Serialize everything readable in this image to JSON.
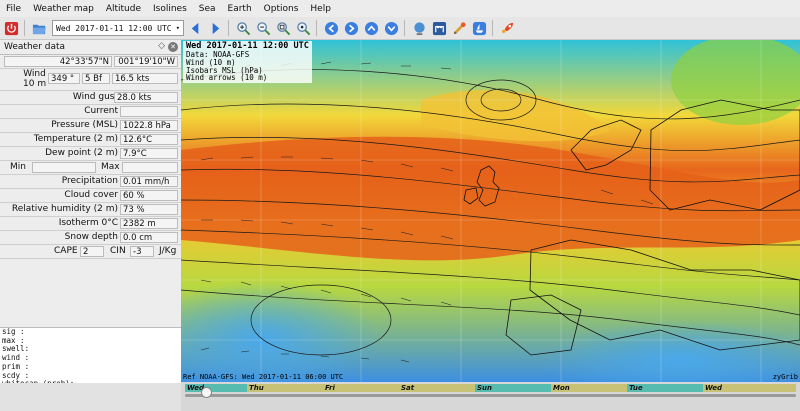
{
  "menu": [
    "File",
    "Weather map",
    "Altitude",
    "Isolines",
    "Sea",
    "Earth",
    "Options",
    "Help"
  ],
  "toolbar": {
    "date_select": "Wed 2017-01-11 12:00 UTC",
    "accent_color": "#d52b2b",
    "icons": [
      "quit-icon",
      "open-file-icon",
      "previous-icon",
      "next-icon",
      "zoom-in-icon",
      "zoom-out-icon",
      "zoom-fit-icon",
      "zoom-selection-icon",
      "go-left-icon",
      "go-right-icon",
      "go-up-icon",
      "go-down-icon",
      "globe-icon",
      "meteotable-icon",
      "route-icon",
      "boat-icon",
      "rocket-icon"
    ]
  },
  "panel": {
    "title": "Weather data",
    "lat": "42°33'57\"N",
    "lon": "001°19'10\"W",
    "wind_label_1": "Wind",
    "wind_label_2": "10 m",
    "wind_dir": "349 °",
    "wind_bf": "5 Bf",
    "wind_speed": "16.5  kts",
    "rows": [
      {
        "label": "Wind gust",
        "value": "28.0  kts"
      },
      {
        "label": "Current",
        "value": ""
      },
      {
        "label": "Pressure (MSL)",
        "value": "1022.8 hPa"
      },
      {
        "label": "Temperature (2 m)",
        "value": "12.6°C"
      },
      {
        "label": "Dew point (2 m)",
        "value": "7.9°C"
      }
    ],
    "minmax": {
      "min": "Min",
      "max": "Max"
    },
    "rows2": [
      {
        "label": "Precipitation",
        "value": "0.01 mm/h"
      },
      {
        "label": "Cloud cover",
        "value": "60 %"
      },
      {
        "label": "Relative humidity (2 m)",
        "value": "73 %"
      },
      {
        "label": "Isotherm 0°C",
        "value": "2382 m"
      },
      {
        "label": "Snow depth",
        "value": "0.0 cm"
      }
    ],
    "cape": {
      "cape_label": "CAPE",
      "cape_value": "2",
      "cin_label": "CIN",
      "cin_value": "-3",
      "unit": "J/Kg"
    },
    "text_lines": [
      "sig  :",
      "max  :",
      "swell:",
      "wind :",
      "prim :",
      "scdy :",
      "whitecap (prob):"
    ]
  },
  "map": {
    "legend_title": "Wed 2017-01-11 12:00 UTC",
    "legend_lines": [
      "Data: NOAA-GFS",
      "Wind (10 m)",
      "Isobars MSL (hPa)",
      "Wind arrows (10 m)"
    ],
    "ref_text": "Ref NOAA-GFS: Wed 2017-01-11 06:00 UTC",
    "file_label": "zyGrib",
    "colors": {
      "sea_low": "#3a8fe0",
      "mid": "#f0e040",
      "high": "#e8601a",
      "land_line": "#000000"
    }
  },
  "timeline": {
    "days": [
      "Wed",
      "Thu",
      "Fri",
      "Sat",
      "Sun",
      "Mon",
      "Tue",
      "Wed"
    ],
    "current_index": 0
  }
}
